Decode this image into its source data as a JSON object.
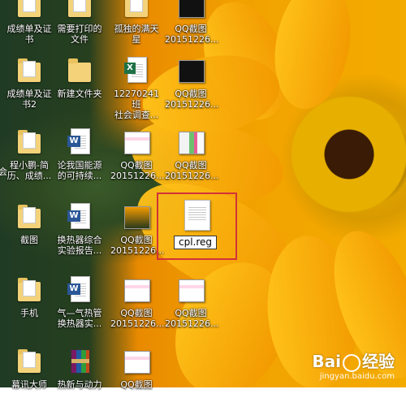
{
  "desktop": {
    "icons": [
      {
        "label": "成绩单及证\n书",
        "type": "folder"
      },
      {
        "label": "需要打印的\n文件",
        "type": "folder"
      },
      {
        "label": "孤独的满天\n星",
        "type": "folder"
      },
      {
        "label": "QQ截图\n20151226...",
        "type": "screenshot-dark"
      },
      {
        "label": "成绩单及证\n书2",
        "type": "folder"
      },
      {
        "label": "新建文件夹",
        "type": "folder"
      },
      {
        "label": "12270241班\n社会调查...",
        "type": "excel"
      },
      {
        "label": "QQ截图\n20151226...",
        "type": "screenshot-dark"
      },
      {
        "label": "程小鹏-简\n历、成绩...",
        "type": "folder"
      },
      {
        "label": "论我国能源\n的可持续...",
        "type": "word"
      },
      {
        "label": "QQ截图\n20151226...",
        "type": "screenshot-light"
      },
      {
        "label": "QQ截图\n20151226...",
        "type": "screenshot-green"
      },
      {
        "label": "截图",
        "type": "folder"
      },
      {
        "label": "换热器综合\n实验报告...",
        "type": "word"
      },
      {
        "label": "QQ截图\n20151226...",
        "type": "screenshot-orange"
      },
      {
        "label": "手机",
        "type": "folder"
      },
      {
        "label": "气—气热管\n换热器实...",
        "type": "word"
      },
      {
        "label": "QQ截图\n20151226...",
        "type": "screenshot-light"
      },
      {
        "label": "QQ截图\n20151226...",
        "type": "screenshot-light"
      }
    ],
    "selected_file": {
      "label": "cpl.reg",
      "type": "reg-file"
    },
    "partial_labels": [
      "会",
      "幕讯大师",
      "热新与动力",
      "QQ截图"
    ]
  },
  "watermark": {
    "brand": "Bai",
    "brand_suffix": "经验",
    "url": "jingyan.baidu.com"
  }
}
